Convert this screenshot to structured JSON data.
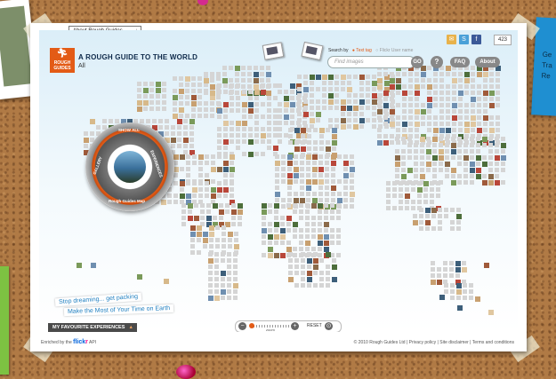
{
  "header": {
    "dropdown_label": "About Rough Guides",
    "dropdown_arrow": "↓",
    "logo_top": "ROUGH",
    "logo_bottom": "GUIDES",
    "logo_icon": "runner-icon",
    "title": "A ROUGH GUIDE TO THE WORLD",
    "subtitle": "All",
    "share_count": "423"
  },
  "search": {
    "label": "Search by",
    "option_text_tag": "Text tag",
    "option_flickr_user": "Flickr User name",
    "placeholder": "Find images",
    "go_label": "GO",
    "help_label": "?",
    "faq_label": "FAQ",
    "about_label": "About"
  },
  "compass": {
    "show_all": "SHOW ALL",
    "left": "GALLERY",
    "right": "EXPERIENCES",
    "bottom": "Rough Guides Map"
  },
  "slogan": {
    "line1": "Stop dreaming... get packing",
    "line2": "Make the Most of Your Time on Earth"
  },
  "favourites": {
    "label": "MY FAVOURITE EXPERIENCES",
    "arrow": "▲"
  },
  "zoom": {
    "minus": "−",
    "plus": "+",
    "label": "zoom",
    "reset": "RESET",
    "level_fraction": 0.05
  },
  "enriched": {
    "prefix": "Enriched by the",
    "flickr_a": "flick",
    "flickr_b": "r",
    "suffix": "API"
  },
  "footer": {
    "text": "© 2010 Rough Guides Ltd | Privacy policy | Site disclaimer | Terms and conditions"
  },
  "sticky_note": {
    "text": "Ge Tra Re"
  },
  "colors": {
    "accent": "#e35b16",
    "title": "#0e2a4a",
    "link_blue": "#1f7fc0"
  }
}
